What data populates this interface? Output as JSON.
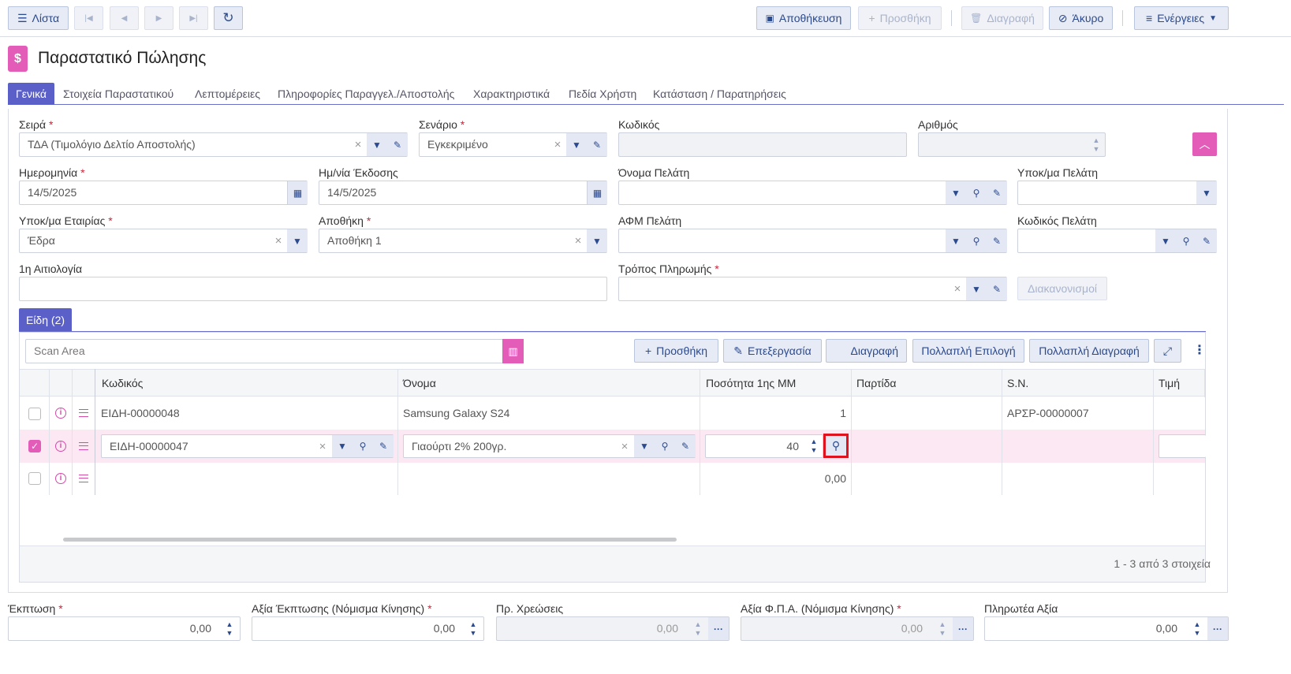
{
  "toolbar": {
    "list": "Λίστα",
    "save": "Αποθήκευση",
    "add": "Προσθήκη",
    "delete": "Διαγραφή",
    "cancel": "Άκυρο",
    "actions": "Ενέργειες"
  },
  "page": {
    "title": "Παραστατικό Πώλησης"
  },
  "tabs": [
    "Γενικά",
    "Στοιχεία Παραστατικού",
    "Λεπτομέρειες",
    "Πληροφορίες Παραγγελ./Αποστολής",
    "Χαρακτηριστικά",
    "Πεδία Χρήστη",
    "Κατάσταση / Παρατηρήσεις"
  ],
  "form": {
    "series": {
      "label": "Σειρά",
      "value": "ΤΔΑ (Τιμολόγιο Δελτίο Αποστολής)"
    },
    "scenario": {
      "label": "Σενάριο",
      "value": "Εγκεκριμένο"
    },
    "code": {
      "label": "Κωδικός",
      "value": ""
    },
    "number": {
      "label": "Αριθμός",
      "value": ""
    },
    "date": {
      "label": "Ημερομηνία",
      "value": "14/5/2025"
    },
    "issue_date": {
      "label": "Ημ/νία Έκδοσης",
      "value": "14/5/2025"
    },
    "customer_name": {
      "label": "Όνομα Πελάτη",
      "value": ""
    },
    "customer_branch": {
      "label": "Υποκ/μα Πελάτη",
      "value": ""
    },
    "company_branch": {
      "label": "Υποκ/μα Εταιρίας",
      "value": "Έδρα"
    },
    "warehouse": {
      "label": "Αποθήκη",
      "value": "Αποθήκη 1"
    },
    "customer_vat": {
      "label": "ΑΦΜ Πελάτη",
      "value": ""
    },
    "customer_code": {
      "label": "Κωδικός Πελάτη",
      "value": ""
    },
    "reason": {
      "label": "1η Αιτιολογία",
      "value": ""
    },
    "payment": {
      "label": "Τρόπος Πληρωμής",
      "value": ""
    },
    "settlements": "Διακανονισμοί"
  },
  "items": {
    "tab": "Είδη (2)",
    "scan_placeholder": "Scan Area",
    "add": "Προσθήκη",
    "edit": "Επεξεργασία",
    "delete": "Διαγραφή",
    "multi_select": "Πολλαπλή Επιλογή",
    "multi_delete": "Πολλαπλή Διαγραφή",
    "columns": [
      "Κωδικός",
      "Όνομα",
      "Ποσότητα 1ης ΜΜ",
      "Παρτίδα",
      "S.N.",
      "Τιμή"
    ],
    "rows": [
      {
        "code": "ΕΙΔΗ-00000048",
        "name": "Samsung Galaxy S24",
        "qty": "1",
        "batch": "",
        "sn": "ΑΡΣΡ-00000007"
      },
      {
        "code": "ΕΙΔΗ-00000047",
        "name": "Γιαούρτι 2% 200γρ.",
        "qty": "40",
        "batch": "",
        "sn": ""
      },
      {
        "code": "",
        "name": "",
        "qty": "0,00",
        "batch": "",
        "sn": ""
      }
    ],
    "pager": "1 - 3 από 3 στοιχεία"
  },
  "totals": {
    "discount": {
      "label": "Έκπτωση",
      "value": "0,00"
    },
    "discount_value": {
      "label": "Αξία Έκπτωσης (Νόμισμα Κίνησης)",
      "value": "0,00"
    },
    "charges": {
      "label": "Πρ. Χρεώσεις",
      "value": "0,00"
    },
    "vat_value": {
      "label": "Αξία Φ.Π.Α. (Νόμισμα Κίνησης)",
      "value": "0,00"
    },
    "payable": {
      "label": "Πληρωτέα Αξία",
      "value": "0,00"
    }
  }
}
